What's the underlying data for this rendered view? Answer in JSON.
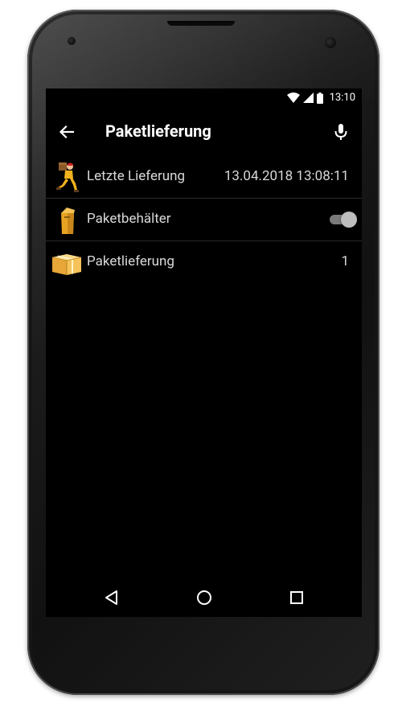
{
  "status_bar": {
    "time": "13:10",
    "wifi_icon": "wifi-icon",
    "signal_icon": "cell-signal-icon",
    "battery_icon": "battery-icon"
  },
  "toolbar": {
    "title": "Paketlieferung",
    "back_icon": "arrow-back-icon",
    "mic_icon": "microphone-icon"
  },
  "list": {
    "items": [
      {
        "icon": "delivery-man-icon",
        "label": "Letzte Lieferung",
        "value": "13.04.2018 13:08:11"
      },
      {
        "icon": "parcel-box-icon",
        "label": "Paketbehälter",
        "toggle": "off"
      },
      {
        "icon": "package-icon",
        "label": "Paketlieferung",
        "value": "1"
      }
    ]
  },
  "nav_bar": {
    "back_icon": "nav-back-icon",
    "home_icon": "nav-home-icon",
    "recents_icon": "nav-recents-icon"
  },
  "colors": {
    "screen_bg": "#000000",
    "text_primary": "#ffffff",
    "text_secondary": "#d8d8d8",
    "icon_orange": "#e8a323"
  }
}
